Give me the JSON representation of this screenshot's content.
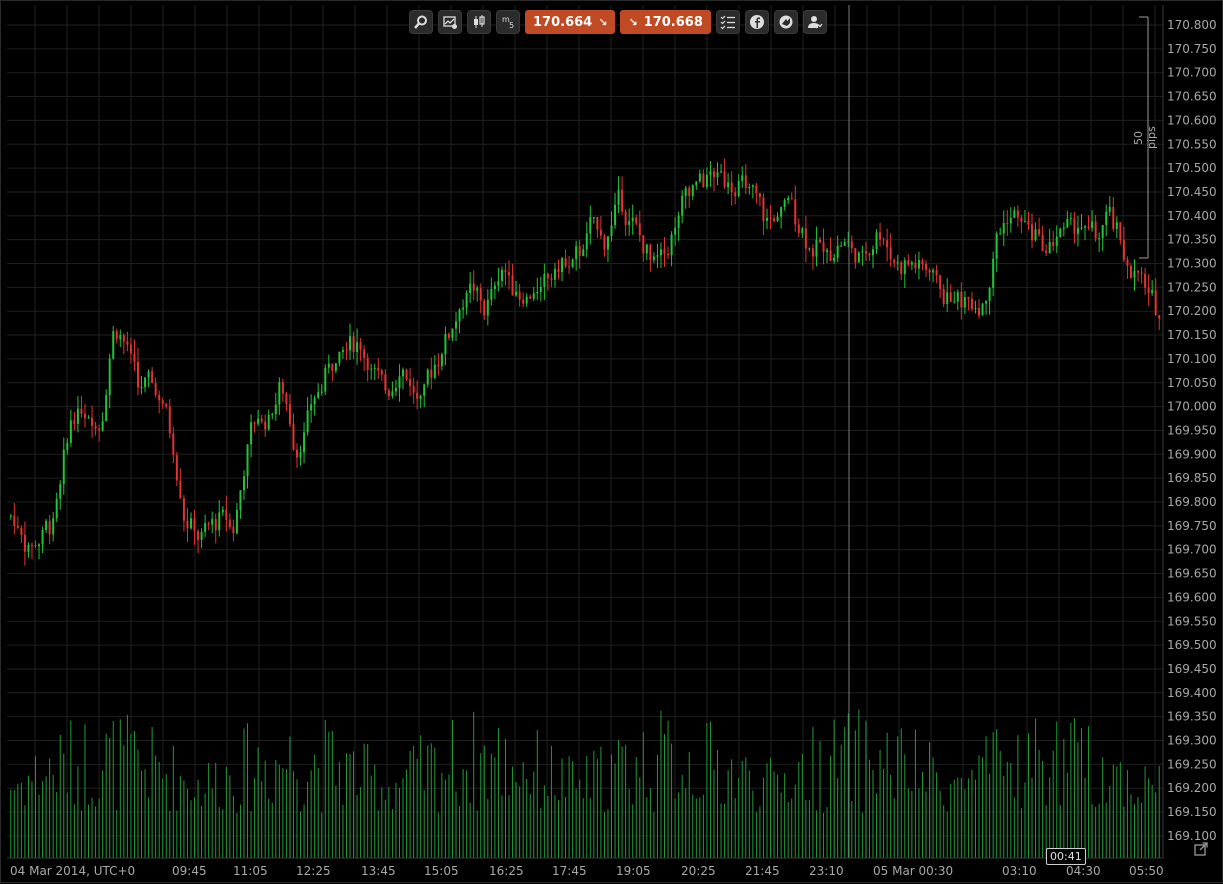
{
  "toolbar": {
    "sell_price": "170.664",
    "buy_price": "170.668",
    "sell_arrow": "↘",
    "buy_arrow": "↘",
    "timeframe": "m5"
  },
  "range_marker_label": "50 pips",
  "countdown": "00:41",
  "colors": {
    "background": "#000000",
    "grid": "#1f1f1f",
    "up": "#22c33a",
    "down": "#e23232",
    "volume": "#1f9a3c",
    "price_button": "#c04a23"
  },
  "chart_data": {
    "type": "candlestick",
    "instrument_price_scale": "right",
    "grid": true,
    "ylim": [
      169.1,
      170.83
    ],
    "y_ticks": [
      "170.800",
      "170.750",
      "170.700",
      "170.650",
      "170.600",
      "170.550",
      "170.500",
      "170.450",
      "170.400",
      "170.350",
      "170.300",
      "170.250",
      "170.200",
      "170.150",
      "170.100",
      "170.050",
      "170.000",
      "169.950",
      "169.900",
      "169.850",
      "169.800",
      "169.750",
      "169.700",
      "169.650",
      "169.600",
      "169.550",
      "169.500",
      "169.450",
      "169.400",
      "169.350",
      "169.300",
      "169.250",
      "169.200",
      "169.150",
      "169.100"
    ],
    "x_labels": [
      "04 Mar 2014, UTC+0",
      "09:45",
      "11:05",
      "12:25",
      "13:45",
      "15:05",
      "16:25",
      "17:45",
      "19:05",
      "20:25",
      "21:45",
      "23:10",
      "05 Mar 00:30",
      "03:10",
      "04:30",
      "05:50"
    ],
    "anchors": [
      [
        0,
        169.77
      ],
      [
        5,
        169.7
      ],
      [
        12,
        169.77
      ],
      [
        17,
        170.0
      ],
      [
        21,
        169.98
      ],
      [
        25,
        169.97
      ],
      [
        29,
        170.2
      ],
      [
        32,
        170.13
      ],
      [
        36,
        170.03
      ],
      [
        40,
        170.05
      ],
      [
        44,
        169.97
      ],
      [
        49,
        169.75
      ],
      [
        54,
        169.72
      ],
      [
        59,
        169.78
      ],
      [
        63,
        169.75
      ],
      [
        67,
        169.96
      ],
      [
        72,
        169.98
      ],
      [
        76,
        170.05
      ],
      [
        80,
        169.9
      ],
      [
        84,
        169.98
      ],
      [
        90,
        170.1
      ],
      [
        96,
        170.15
      ],
      [
        101,
        170.1
      ],
      [
        105,
        170.02
      ],
      [
        110,
        170.1
      ],
      [
        115,
        170.0
      ],
      [
        119,
        170.09
      ],
      [
        124,
        170.17
      ],
      [
        129,
        170.25
      ],
      [
        134,
        170.2
      ],
      [
        139,
        170.3
      ],
      [
        144,
        170.22
      ],
      [
        149,
        170.24
      ],
      [
        154,
        170.3
      ],
      [
        159,
        170.3
      ],
      [
        164,
        170.38
      ],
      [
        168,
        170.35
      ],
      [
        172,
        170.45
      ],
      [
        177,
        170.35
      ],
      [
        181,
        170.3
      ],
      [
        186,
        170.35
      ],
      [
        191,
        170.45
      ],
      [
        196,
        170.48
      ],
      [
        203,
        170.48
      ],
      [
        209,
        170.44
      ],
      [
        214,
        170.38
      ],
      [
        220,
        170.43
      ],
      [
        225,
        170.35
      ],
      [
        230,
        170.32
      ],
      [
        235,
        170.35
      ],
      [
        240,
        170.3
      ],
      [
        245,
        170.38
      ],
      [
        250,
        170.3
      ],
      [
        255,
        170.3
      ],
      [
        260,
        170.28
      ],
      [
        265,
        170.22
      ],
      [
        270,
        170.23
      ],
      [
        275,
        170.22
      ],
      [
        279,
        170.38
      ],
      [
        283,
        170.4
      ],
      [
        288,
        170.37
      ],
      [
        293,
        170.32
      ],
      [
        297,
        170.38
      ],
      [
        302,
        170.38
      ],
      [
        307,
        170.35
      ],
      [
        311,
        170.4
      ],
      [
        315,
        170.3
      ],
      [
        320,
        170.25
      ],
      [
        323,
        170.2
      ],
      [
        325,
        170.2
      ]
    ],
    "candle_count": 326,
    "volume_panel": true
  }
}
